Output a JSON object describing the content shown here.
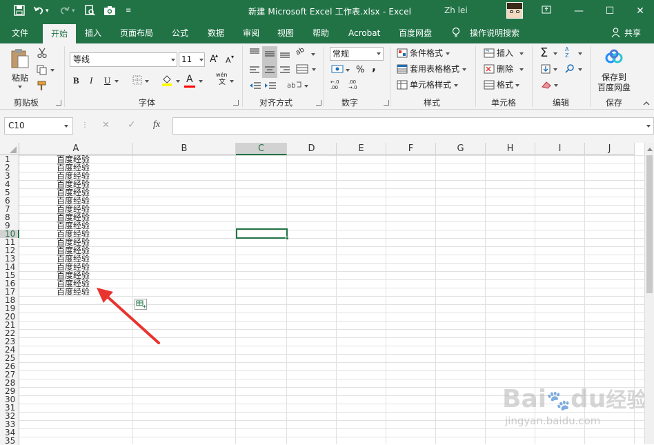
{
  "titlebar": {
    "title": "新建 Microsoft Excel 工作表.xlsx - Excel",
    "account": "Zh     lei     ",
    "icons": [
      "save-icon",
      "undo-icon",
      "redo-icon",
      "print-preview-icon",
      "camera-icon",
      "customize-qat-icon",
      "ribbon-display-icon",
      "minimize-icon",
      "maximize-icon",
      "close-icon"
    ]
  },
  "tabs": [
    "文件",
    "开始",
    "插入",
    "页面布局",
    "公式",
    "数据",
    "审阅",
    "视图",
    "帮助",
    "Acrobat",
    "百度网盘",
    "操作说明搜索",
    "共享"
  ],
  "ribbon": {
    "clipboard": {
      "paste": "粘贴",
      "group": "剪贴板"
    },
    "font": {
      "family": "等线",
      "size": "11",
      "group": "字体",
      "grow": "A",
      "shrink": "A",
      "bold": "B",
      "italic": "I",
      "underline": "U",
      "color_letter": "A",
      "phonetic_top": "wén",
      "phonetic_bottom": "文",
      "fill_color": "#ffff00",
      "font_color": "#ff0000"
    },
    "alignment": {
      "group": "对齐方式",
      "orientation": "ab"
    },
    "number": {
      "format": "常规",
      "group": "数字",
      "percent": "%",
      "comma": ",",
      "inc_decimal": "←.0 .00",
      "dec_decimal": ".00 →.0"
    },
    "styles": {
      "conditional": "条件格式",
      "table": "套用表格格式",
      "cell": "单元格样式",
      "group": "样式"
    },
    "cells": {
      "insert": "插入",
      "delete": "删除",
      "format": "格式",
      "group": "单元格"
    },
    "editing": {
      "group": "编辑",
      "sum": "Σ",
      "sort": "A Z"
    },
    "save": {
      "line1": "保存到",
      "line2": "百度网盘",
      "group": "保存"
    }
  },
  "formula_bar": {
    "name_box": "C10",
    "cancel": "✕",
    "enter": "✓",
    "fx": "fx",
    "content": ""
  },
  "sheet": {
    "columns": [
      "A",
      "B",
      "C",
      "D",
      "E",
      "F",
      "G",
      "H",
      "I",
      "J"
    ],
    "selected_column": "C",
    "selected_row": "10",
    "active_cell": "C10",
    "rows": [
      "1",
      "2",
      "3",
      "4",
      "5",
      "6",
      "7",
      "8",
      "9",
      "10",
      "11",
      "12",
      "13",
      "14",
      "15",
      "16",
      "17",
      "18",
      "19",
      "20",
      "21",
      "22",
      "23",
      "24",
      "25",
      "26",
      "27",
      "28",
      "29",
      "30",
      "31",
      "32",
      "33",
      "34",
      "35"
    ],
    "column_a_values": [
      "百度经验",
      "百度经验",
      "百度经验",
      "百度经验",
      "百度经验",
      "百度经验",
      "百度经验",
      "百度经验",
      "百度经验",
      "百度经验",
      "百度经验",
      "百度经验",
      "百度经验",
      "百度经验",
      "百度经验",
      "百度经验",
      "百度经验"
    ]
  },
  "overlay": {
    "arrow_color": "#e8332e",
    "watermark_text": "Bai",
    "watermark_text2": "du",
    "watermark_text3": "经验",
    "watermark_url": "jingyan.baidu.com"
  }
}
